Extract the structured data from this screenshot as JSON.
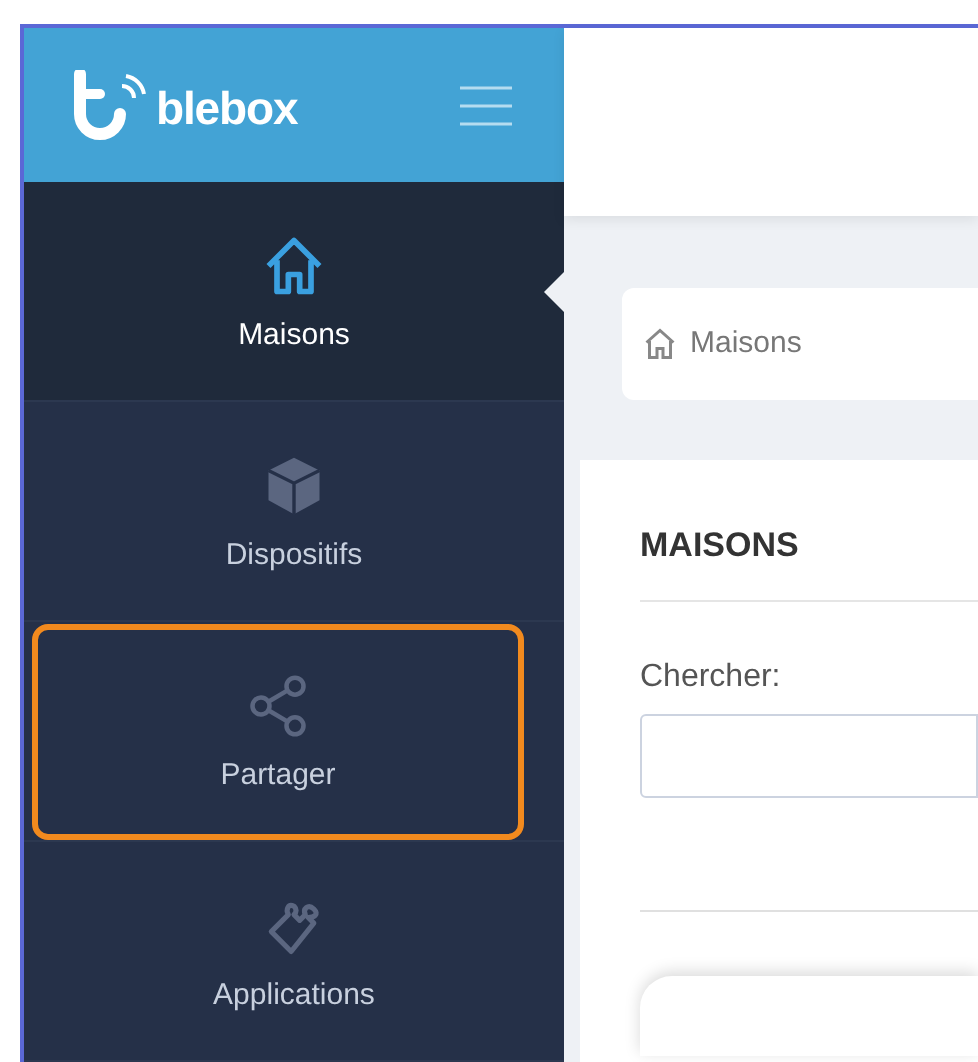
{
  "logo": {
    "text": "blebox"
  },
  "sidebar": {
    "items": [
      {
        "label": "Maisons",
        "kind": "house",
        "selected": true,
        "highlighted": false
      },
      {
        "label": "Dispositifs",
        "kind": "cube",
        "selected": false,
        "highlighted": false
      },
      {
        "label": "Partager",
        "kind": "share",
        "selected": false,
        "highlighted": true
      },
      {
        "label": "Applications",
        "kind": "puzzle",
        "selected": false,
        "highlighted": false
      }
    ]
  },
  "breadcrumb": {
    "label": "Maisons"
  },
  "panel": {
    "title": "MAISONS",
    "search": {
      "label": "Chercher:"
    }
  }
}
